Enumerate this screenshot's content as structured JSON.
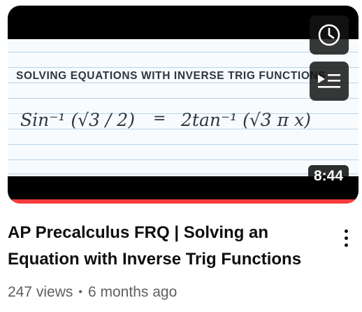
{
  "thumbnail": {
    "slide_title": "SOLVING EQUATIONS WITH INVERSE TRIG FUNCTIONS",
    "equation_left": "Sin⁻¹ (√3 / 2)",
    "equals": "=",
    "equation_right": "2tan⁻¹ (√3 π x)",
    "duration": "8:44",
    "progress_fraction": 1.0,
    "icons": {
      "watch_later": "clock-icon",
      "add_to_queue": "add-to-queue-icon"
    }
  },
  "video": {
    "title": "AP Precalculus FRQ | Solving an Equation with Inverse Trig Functions",
    "views": "247 views",
    "separator": "•",
    "age": "6 months ago"
  },
  "menu": {
    "icon": "more-vertical-icon"
  },
  "colors": {
    "progress": "#ff3b3b",
    "title_text": "#0f0f0f",
    "meta_text": "#606060",
    "ink": "#2c3742"
  }
}
